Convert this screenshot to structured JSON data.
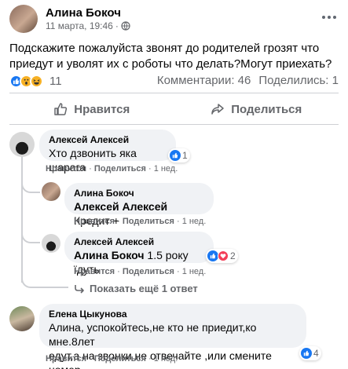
{
  "post": {
    "author": "Алина Бокоч",
    "date": "11 марта, 19:46",
    "separator": "·",
    "text": "Подскажите пожалуйста звонят до родителей грозят что приедут и уволят их с роботы что делать?Могут приехать?",
    "reactions_count": "11",
    "comments_label": "Комментарии: 46",
    "shares_label": "Поделились: 1"
  },
  "actions": {
    "like": "Нравится",
    "share": "Поделиться"
  },
  "comments": [
    {
      "name": "Алексей Алексей",
      "text": "Хто дзвонить яка шарага",
      "reactions": "1",
      "like": "Нравится",
      "reply": "Поделиться",
      "time": "1 нед."
    },
    {
      "name": "Алина Бокоч",
      "mention": "Алексей Алексей",
      "text": " Кредит +",
      "like": "Нравится",
      "reply": "Поделиться",
      "time": "1 нед."
    },
    {
      "name": "Алексей Алексей",
      "mention": "Алина Бокоч",
      "text": " 1.5 року їдуть",
      "reactions": "2",
      "like": "Нравится",
      "reply": "Поделиться",
      "time": "1 нед."
    },
    {
      "name": "Елена Цыкунова",
      "text_line1": "Алина, успокойтесь,не кто не приедит,ко мне.8лет",
      "text_line2": "едут,а на звонки не отвечайте ,или смените номер.",
      "reactions": "4",
      "like": "Нравится",
      "reply": "Поделиться",
      "time": "1 нед."
    }
  ],
  "show_more": "Показать ещё 1 ответ",
  "foot_sep": " · ",
  "colors": {
    "like_blue": "#1877f2",
    "secondary_text": "#65676b",
    "bubble_bg": "#f0f2f5"
  }
}
